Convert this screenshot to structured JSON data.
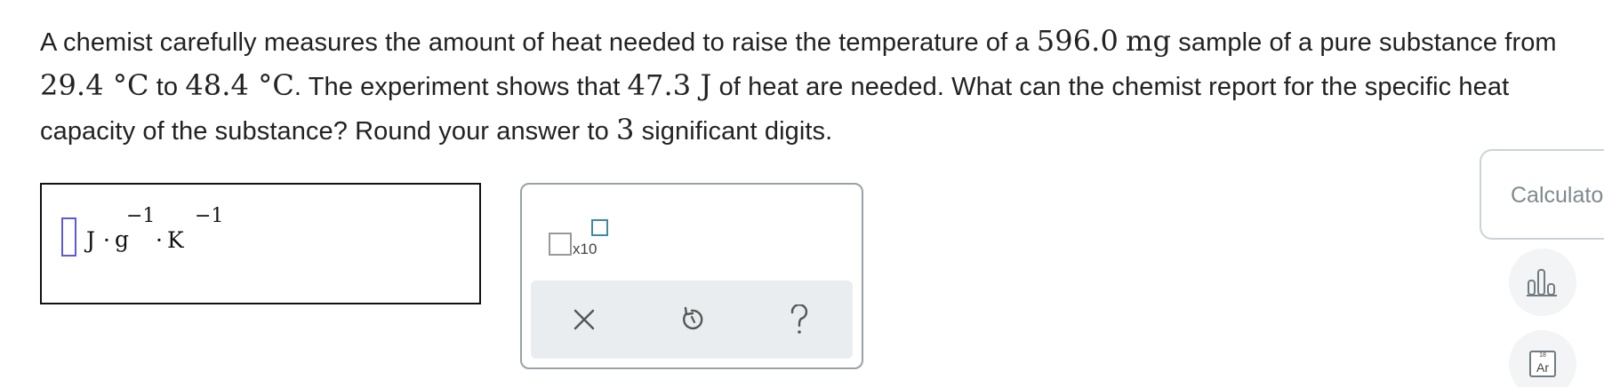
{
  "question": {
    "t1": "A chemist carefully measures the amount of heat needed to raise the temperature of a ",
    "mass": "596.0",
    "mass_unit": "mg",
    "t2": " sample of a pure substance from ",
    "temp1": "29.4 °C",
    "t3": " to ",
    "temp2": "48.4 °C",
    "t4": ". The experiment shows that ",
    "heat": "47.3 J",
    "t5": " of heat are needed. What can the chemist report for the specific heat capacity of the substance? Round your answer to ",
    "sig": "3",
    "t6": " significant digits."
  },
  "answer": {
    "unit_J": "J",
    "dot1": "·",
    "unit_g": "g",
    "exp_g": "−1",
    "dot2": "·",
    "unit_K": "K",
    "exp_K": "−1"
  },
  "toolbox": {
    "x10_label": "x10"
  },
  "side": {
    "calculator_label": "Calculator",
    "periodic_number": "18",
    "periodic_symbol": "Ar"
  },
  "icons": {
    "clear": "close-icon",
    "undo": "undo-icon",
    "help": "help-icon",
    "chart": "bar-chart-icon",
    "periodic": "periodic-table-icon"
  },
  "colors": {
    "slot_border": "#5a5adf",
    "exponent_box": "#3d8aa3",
    "action_bar_bg": "#e9edf0",
    "icon_gray": "#555555"
  }
}
